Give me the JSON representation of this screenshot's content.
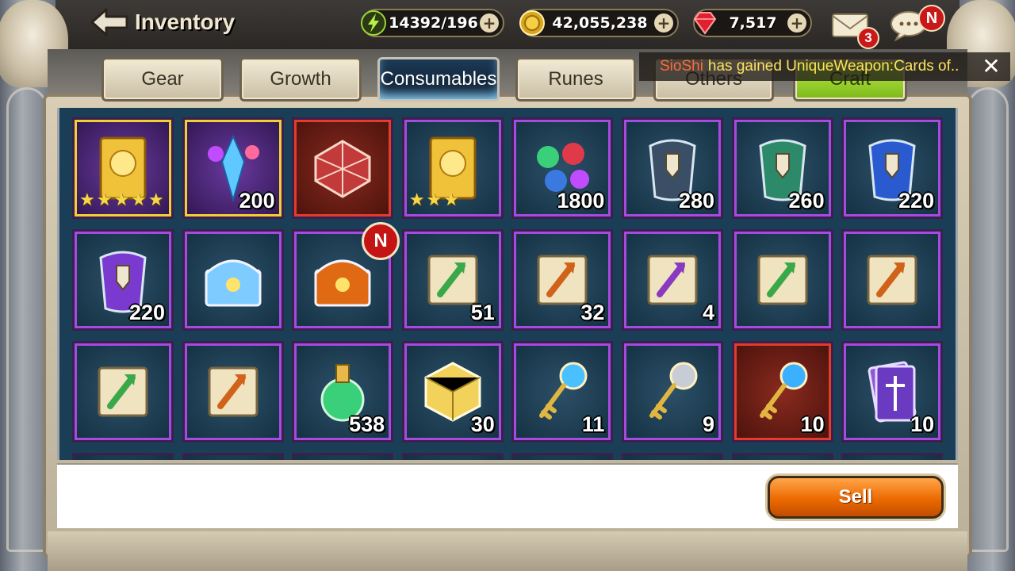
{
  "header": {
    "title": "Inventory",
    "energy": "14392/196",
    "gold": "42,055,238",
    "ruby": "7,517",
    "mail_count": "3",
    "chat_badge": "N"
  },
  "tabs": [
    {
      "label": "Gear"
    },
    {
      "label": "Growth"
    },
    {
      "label": "Consumables"
    },
    {
      "label": "Runes"
    },
    {
      "label": "Others"
    },
    {
      "label": "Craft"
    }
  ],
  "active_tab": "Consumables",
  "notice": {
    "player": "SioShi",
    "message": "has gained UniqueWeapon:Cards of.."
  },
  "items": [
    {
      "icon": "gold-card-icon",
      "quantity": "",
      "stars": "★★★★★",
      "rarity": "gold"
    },
    {
      "icon": "crystal-bundle-icon",
      "quantity": "200",
      "stars": "",
      "rarity": "gold"
    },
    {
      "icon": "red-box-icon",
      "quantity": "",
      "stars": "",
      "rarity": "red"
    },
    {
      "icon": "gold-card-icon",
      "quantity": "",
      "stars": "★★★",
      "rarity": "purple"
    },
    {
      "icon": "gem-pile-icon",
      "quantity": "1800",
      "stars": "",
      "rarity": "purple"
    },
    {
      "icon": "dark-cloak-icon",
      "quantity": "280",
      "stars": "",
      "rarity": "purple"
    },
    {
      "icon": "green-cloak-icon",
      "quantity": "260",
      "stars": "",
      "rarity": "purple"
    },
    {
      "icon": "blue-cloak-icon",
      "quantity": "220",
      "stars": "",
      "rarity": "purple"
    },
    {
      "icon": "purple-cloak-icon",
      "quantity": "220",
      "stars": "",
      "rarity": "purple"
    },
    {
      "icon": "crystal-chest-icon",
      "quantity": "",
      "stars": "",
      "rarity": "purple"
    },
    {
      "icon": "fire-chest-icon",
      "quantity": "",
      "stars": "",
      "rarity": "purple"
    },
    {
      "icon": "exp-scroll-icon",
      "quantity": "51",
      "stars": "",
      "rarity": "purple"
    },
    {
      "icon": "gold-scroll-icon",
      "quantity": "32",
      "stars": "",
      "rarity": "purple"
    },
    {
      "icon": "ring-scroll-icon",
      "quantity": "4",
      "stars": "",
      "rarity": "purple"
    },
    {
      "icon": "exp-scroll-7day-icon",
      "quantity": "",
      "stars": "",
      "rarity": "purple"
    },
    {
      "icon": "gold-scroll-7day-icon",
      "quantity": "",
      "stars": "",
      "rarity": "purple"
    },
    {
      "icon": "exp-scroll-1day-icon",
      "quantity": "",
      "stars": "",
      "rarity": "purple"
    },
    {
      "icon": "gold-scroll-1day-icon",
      "quantity": "",
      "stars": "",
      "rarity": "purple"
    },
    {
      "icon": "green-potion-icon",
      "quantity": "538",
      "stars": "",
      "rarity": "purple"
    },
    {
      "icon": "gold-cube-icon",
      "quantity": "30",
      "stars": "",
      "rarity": "purple"
    },
    {
      "icon": "gold-key-icon",
      "quantity": "11",
      "stars": "",
      "rarity": "purple"
    },
    {
      "icon": "silver-key-icon",
      "quantity": "9",
      "stars": "",
      "rarity": "purple"
    },
    {
      "icon": "blue-gem-key-icon",
      "quantity": "10",
      "stars": "",
      "rarity": "red"
    },
    {
      "icon": "card-pack-icon",
      "quantity": "10",
      "stars": "",
      "rarity": "purple"
    }
  ],
  "new_badge": "N",
  "sell_label": "Sell",
  "colors": {
    "gold_frame": "#f2cf35",
    "purple_frame": "#a44be0",
    "red_frame": "#e23c2a",
    "sell_orange": "#ec6a00",
    "craft_green": "#9bd52a"
  }
}
